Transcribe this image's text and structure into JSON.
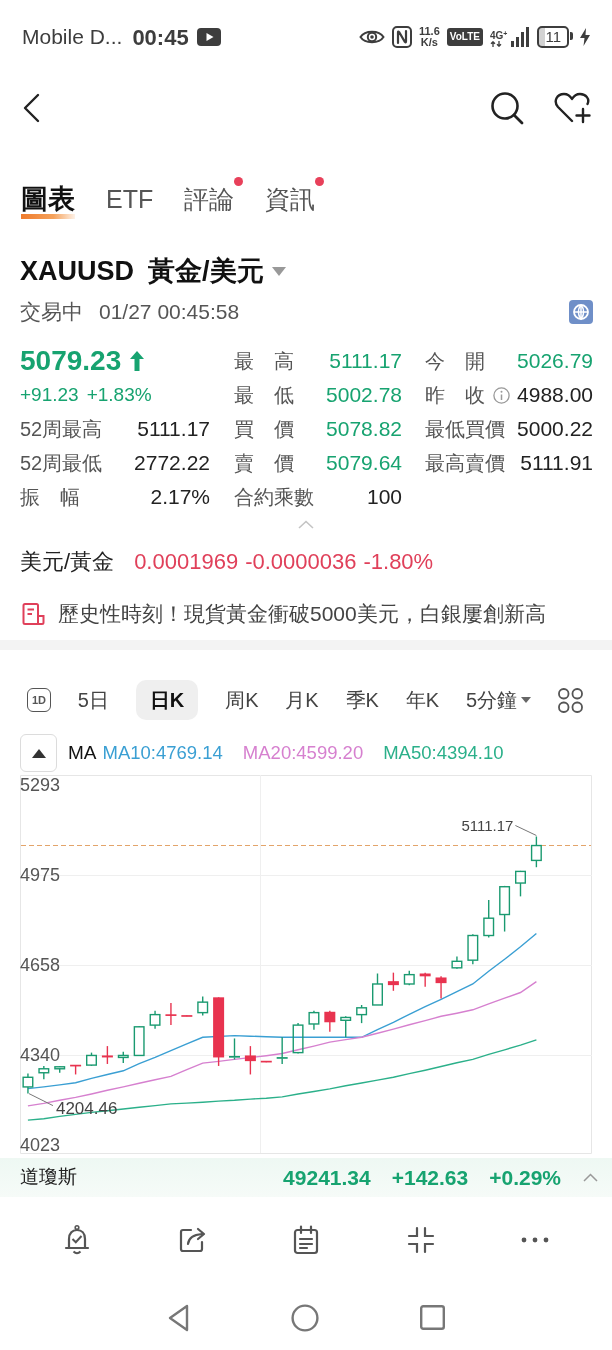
{
  "status_bar": {
    "carrier": "Mobile D...",
    "time": "00:45",
    "speed_value": "11.6",
    "speed_unit": "K/s",
    "volte": "VoLTE",
    "network": "4G$^{+}$",
    "battery": "11",
    "charging": true
  },
  "tabs": [
    {
      "label": "圖表",
      "selected": true,
      "unread": false
    },
    {
      "label": "ETF",
      "selected": false,
      "unread": false
    },
    {
      "label": "評論",
      "selected": false,
      "unread": true
    },
    {
      "label": "資訊",
      "selected": false,
      "unread": true
    }
  ],
  "instrument": {
    "symbol": "XAUUSD",
    "name": "黃金/美元",
    "status": "交易中",
    "timestamp": "01/27 00:45:58"
  },
  "quote": {
    "price": "5079.23",
    "gain": true,
    "change": "+91.23",
    "change_percent": "+1.83%"
  },
  "stats": {
    "columns": [
      [
        {
          "label": "52周最高",
          "value": "5111.17",
          "gain": false,
          "info": false
        },
        {
          "label": "52周最低",
          "value": "2772.22",
          "gain": false,
          "info": false
        },
        {
          "label": "振　幅",
          "value": "2.17%",
          "gain": false,
          "info": false
        }
      ],
      [
        {
          "label": "最　高",
          "value": "5111.17",
          "gain": true,
          "info": false
        },
        {
          "label": "最　低",
          "value": "5002.78",
          "gain": true,
          "info": false
        },
        {
          "label": "買　價",
          "value": "5078.82",
          "gain": true,
          "info": false
        },
        {
          "label": "賣　價",
          "value": "5079.64",
          "gain": true,
          "info": false
        },
        {
          "label": "合約乘數",
          "value": "100",
          "gain": false,
          "info": false
        }
      ],
      [
        {
          "label": "今　開",
          "value": "5026.79",
          "gain": true,
          "info": false
        },
        {
          "label": "昨　收",
          "value": "4988.00",
          "gain": false,
          "info": true
        },
        {
          "label": "最低買價",
          "value": "5000.22",
          "gain": false,
          "info": false
        },
        {
          "label": "最高賣價",
          "value": "5111.91",
          "gain": false,
          "info": false
        }
      ]
    ]
  },
  "fx": {
    "label": "美元/黃金",
    "value": "0.0001969",
    "change": "-0.0000036",
    "change_percent": "-1.80%",
    "loss": true
  },
  "news": {
    "headline": "歷史性時刻！現貨黃金衝破5000美元，白銀屢創新高"
  },
  "chart_toolbar": {
    "periods": [
      {
        "label": "1D",
        "kind": "badge",
        "selected": false
      },
      {
        "label": "5日",
        "kind": "text",
        "selected": false
      },
      {
        "label": "日K",
        "kind": "text",
        "selected": true
      },
      {
        "label": "周K",
        "kind": "text",
        "selected": false
      },
      {
        "label": "月K",
        "kind": "text",
        "selected": false
      },
      {
        "label": "季K",
        "kind": "text",
        "selected": false
      },
      {
        "label": "年K",
        "kind": "text",
        "selected": false
      },
      {
        "label": "5分鐘",
        "kind": "dropdown",
        "selected": false
      }
    ]
  },
  "indicators": {
    "name": "MA"
  },
  "chart": {
    "chart_data": {
      "type": "candlestick",
      "categories": [
        null,
        null,
        null,
        null,
        null,
        null,
        null,
        null,
        null,
        null,
        null,
        null,
        null,
        null,
        null,
        null,
        null,
        null,
        null,
        null,
        null,
        null,
        null,
        null,
        null,
        null,
        null,
        null,
        null,
        null,
        null,
        null,
        null,
        null,
        null,
        null
      ],
      "ohlc": [
        [
          4228,
          4275,
          4204.46,
          4262
        ],
        [
          4278,
          4302,
          4255,
          4292
        ],
        [
          4292,
          4302,
          4278,
          4299
        ],
        [
          4305,
          4305,
          4272,
          4302
        ],
        [
          4305,
          4349,
          4302,
          4339
        ],
        [
          4339,
          4372,
          4309,
          4332
        ],
        [
          4332,
          4352,
          4312,
          4339
        ],
        [
          4339,
          4443,
          4338,
          4440
        ],
        [
          4446,
          4497,
          4433,
          4483
        ],
        [
          4483,
          4524,
          4446,
          4480
        ],
        [
          4480,
          4480,
          4477,
          4477
        ],
        [
          4490,
          4547,
          4480,
          4527
        ],
        [
          4544,
          4544,
          4302,
          4332
        ],
        [
          4332,
          4399,
          4325,
          4336
        ],
        [
          4339,
          4372,
          4272,
          4319
        ],
        [
          4319,
          4319,
          4315,
          4315
        ],
        [
          4329,
          4403,
          4309,
          4332
        ],
        [
          4349,
          4453,
          4346,
          4446
        ],
        [
          4450,
          4497,
          4430,
          4490
        ],
        [
          4493,
          4497,
          4423,
          4456
        ],
        [
          4463,
          4477,
          4403,
          4473
        ],
        [
          4483,
          4517,
          4453,
          4507
        ],
        [
          4517,
          4628,
          4516,
          4591
        ],
        [
          4601,
          4631,
          4567,
          4587
        ],
        [
          4591,
          4638,
          4587,
          4624
        ],
        [
          4628,
          4631,
          4581,
          4618
        ],
        [
          4614,
          4618,
          4540,
          4594
        ],
        [
          4648,
          4688,
          4645,
          4671
        ],
        [
          4675,
          4766,
          4661,
          4762
        ],
        [
          4762,
          4887,
          4755,
          4823
        ],
        [
          4836,
          4937,
          4776,
          4934
        ],
        [
          4947,
          4990,
          4900,
          4988
        ],
        [
          5026.79,
          5111.17,
          5002.78,
          5079.23
        ],
        null,
        null,
        null
      ],
      "series": [
        {
          "name": "MA10:4769.14",
          "type": "line",
          "color": "#3a9fd3",
          "values": [
            4222,
            4228,
            4235,
            4243,
            4258,
            4272,
            4285,
            4310,
            4332,
            4356,
            4380,
            4403,
            null,
            4409,
            4407,
            4405,
            4403,
            4403,
            4403,
            4403,
            4403,
            4403,
            4430,
            4456,
            4484,
            4511,
            4537,
            4564,
            4591,
            4636,
            4678,
            4722,
            4769,
            null,
            null,
            null
          ]
        },
        {
          "name": "MA20:4599.20",
          "type": "line",
          "color": "#d680cf",
          "values": [
            4161,
            4170,
            4181,
            4191,
            4203,
            4216,
            4228,
            4241,
            4253,
            4265,
            4289,
            4312,
            4318,
            4325,
            null,
            4338,
            4346,
            4359,
            4372,
            4386,
            4395,
            4403,
            4417,
            4432,
            4447,
            4462,
            4477,
            4488,
            4500,
            4521,
            4541,
            4561,
            4599,
            null,
            null,
            null
          ]
        },
        {
          "name": "MA50:4394.10",
          "type": "line",
          "color": "#2bb08a",
          "values": [
            4111,
            4116,
            4124,
            4131,
            4138,
            4144,
            4150,
            4156,
            4162,
            4168,
            4171,
            4174,
            4178,
            4181,
            4185,
            4188,
            4193,
            4203,
            4212,
            4221,
            4232,
            4242,
            4252,
            4262,
            4275,
            4287,
            4300,
            4313,
            4325,
            4343,
            4359,
            4375,
            4394,
            null,
            null,
            null
          ]
        }
      ],
      "ylim": [
        3995,
        5328
      ],
      "yticks": [
        5293,
        4975,
        4658,
        4340,
        4023
      ],
      "grid": true,
      "ref_lines": [
        {
          "axis": "y",
          "value": 5079.23,
          "color": "#e3a46a"
        }
      ],
      "annotations": [
        "5111.17",
        "4204.46"
      ]
    }
  },
  "ticker": {
    "name": "道瓊斯",
    "value": "49241.34",
    "change": "+142.63",
    "change_percent": "+0.29%",
    "gain": true
  }
}
